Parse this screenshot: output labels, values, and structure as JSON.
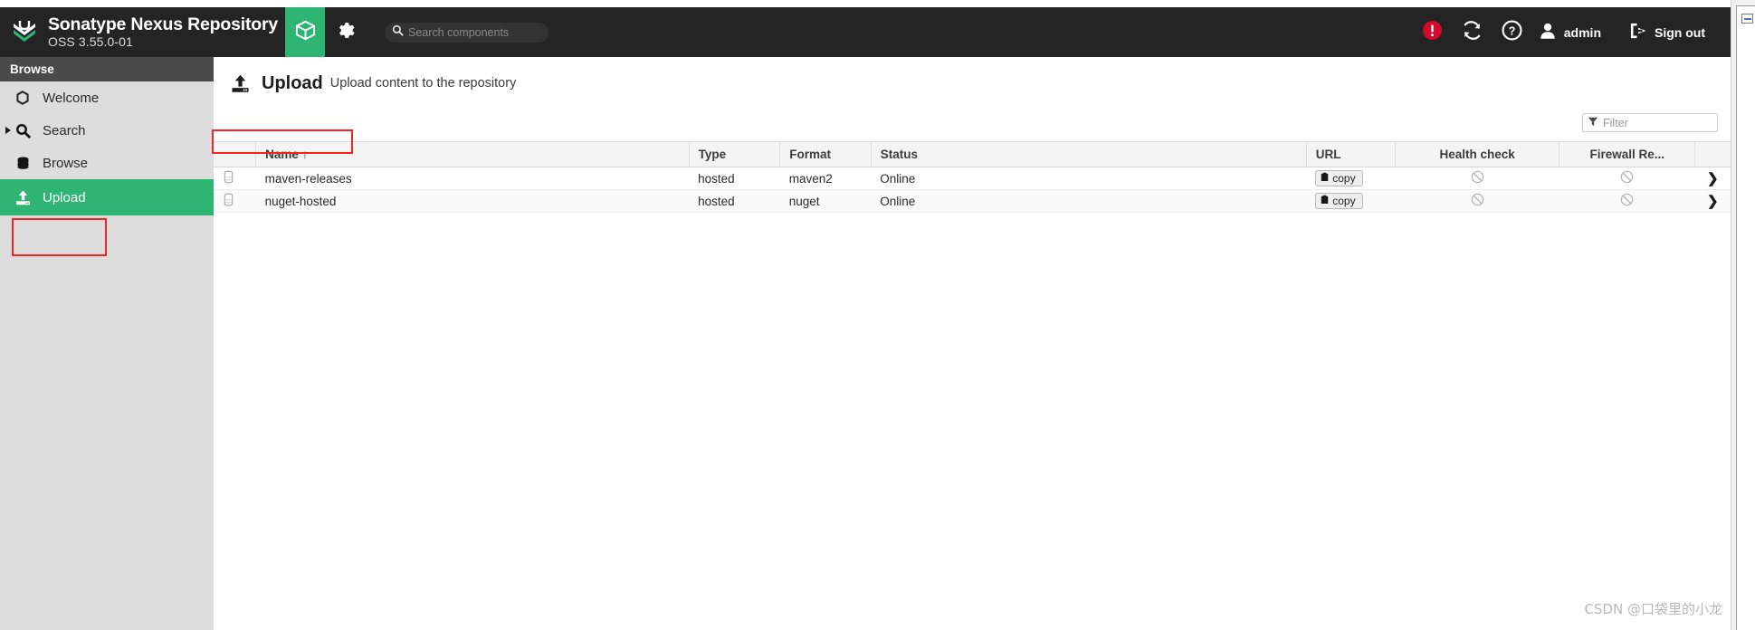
{
  "header": {
    "brand_title": "Sonatype Nexus Repository",
    "brand_subtitle": "OSS 3.55.0-01",
    "logo_icon": "nexus-chevron-logo",
    "tabs": [
      {
        "name": "browse-tab",
        "icon": "cube-icon",
        "active": true
      },
      {
        "name": "admin-tab",
        "icon": "gear-icon",
        "active": false
      }
    ],
    "search": {
      "placeholder": "Search components",
      "value": "",
      "icon": "search-icon"
    },
    "right_items": [
      {
        "name": "alert-indicator",
        "icon": "alert-circle-icon",
        "color": "#cf0a2c",
        "label": ""
      },
      {
        "name": "refresh-button",
        "icon": "refresh-icon",
        "label": ""
      },
      {
        "name": "help-button",
        "icon": "help-circle-icon",
        "label": ""
      },
      {
        "name": "user-menu",
        "icon": "user-icon",
        "label": "admin"
      },
      {
        "name": "sign-out-button",
        "icon": "sign-out-icon",
        "label": "Sign out"
      }
    ]
  },
  "sidebar": {
    "section_title": "Browse",
    "items": [
      {
        "label": "Welcome",
        "icon": "hexagon-icon",
        "active": false,
        "expandable": false
      },
      {
        "label": "Search",
        "icon": "search-icon",
        "active": false,
        "expandable": true
      },
      {
        "label": "Browse",
        "icon": "database-icon",
        "active": false,
        "expandable": false
      },
      {
        "label": "Upload",
        "icon": "upload-icon",
        "active": true,
        "expandable": false
      }
    ]
  },
  "main": {
    "page_icon": "upload-icon",
    "page_title": "Upload",
    "page_subtitle": "Upload content to the repository",
    "filter": {
      "placeholder": "Filter",
      "value": "",
      "icon": "funnel-icon"
    },
    "table": {
      "columns": [
        {
          "label": "",
          "key": "icon",
          "align": "left"
        },
        {
          "label": "Name",
          "key": "name",
          "align": "left",
          "sort": "↑"
        },
        {
          "label": "Type",
          "key": "type",
          "align": "left"
        },
        {
          "label": "Format",
          "key": "format",
          "align": "left"
        },
        {
          "label": "Status",
          "key": "status",
          "align": "left"
        },
        {
          "label": "URL",
          "key": "url",
          "align": "left"
        },
        {
          "label": "Health check",
          "key": "health",
          "align": "center"
        },
        {
          "label": "Firewall Re...",
          "key": "firewall",
          "align": "center"
        },
        {
          "label": "",
          "key": "chevron",
          "align": "center"
        }
      ],
      "rows": [
        {
          "icon": "database-icon",
          "name": "maven-releases",
          "type": "hosted",
          "format": "maven2",
          "status": "Online",
          "url_label": "copy",
          "url_icon": "clipboard-icon",
          "health": "prohibited-icon",
          "firewall": "prohibited-icon",
          "chevron": "chevron-right-icon"
        },
        {
          "icon": "database-icon",
          "name": "nuget-hosted",
          "type": "hosted",
          "format": "nuget",
          "status": "Online",
          "url_label": "copy",
          "url_icon": "clipboard-icon",
          "health": "prohibited-icon",
          "firewall": "prohibited-icon",
          "chevron": "chevron-right-icon"
        }
      ]
    }
  },
  "annotations": {
    "highlight_color": "#f52222",
    "boxes": [
      {
        "name": "sidebar-upload-highlight",
        "target": "Upload"
      },
      {
        "name": "maven-releases-row-highlight",
        "target": "maven-releases"
      }
    ]
  },
  "watermark": {
    "text": "CSDN @口袋里的小龙"
  },
  "colors": {
    "header_bg": "#242424",
    "accent_green": "#2fb573",
    "sidebar_bg": "#dddddd",
    "sidebar_header_bg": "#4a4a4a",
    "alert_red": "#cf0a2c"
  }
}
